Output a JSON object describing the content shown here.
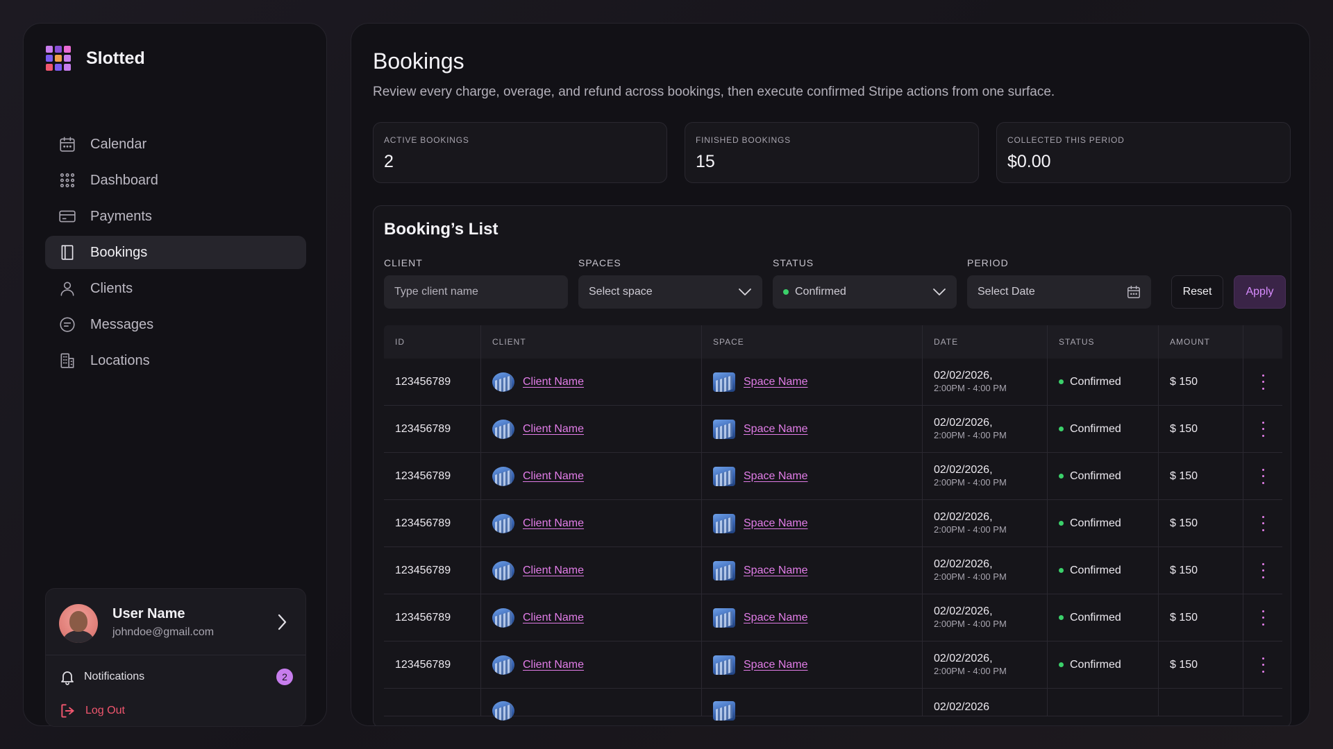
{
  "app": {
    "name": "Slotted",
    "logo_colors": [
      "#c77ded",
      "#8a4fd6",
      "#e96bd4",
      "#7b5cf0",
      "#f0a04b",
      "#c77ded",
      "#f0566e",
      "#7b5cf0",
      "#c77ded"
    ]
  },
  "nav": [
    {
      "label": "Calendar",
      "icon": "calendar-icon",
      "active": false
    },
    {
      "label": "Dashboard",
      "icon": "grid-icon",
      "active": false
    },
    {
      "label": "Payments",
      "icon": "credit-card-icon",
      "active": false
    },
    {
      "label": "Bookings",
      "icon": "book-icon",
      "active": true
    },
    {
      "label": "Clients",
      "icon": "user-icon",
      "active": false
    },
    {
      "label": "Messages",
      "icon": "message-icon",
      "active": false
    },
    {
      "label": "Locations",
      "icon": "building-icon",
      "active": false
    }
  ],
  "user": {
    "name": "User Name",
    "email": "johndoe@gmail.com",
    "notifications_label": "Notifications",
    "notifications_count": "2",
    "logout_label": "Log Out"
  },
  "page": {
    "title": "Bookings",
    "subtitle": "Review every charge, overage, and refund across bookings, then execute confirmed Stripe actions from one surface."
  },
  "stats": [
    {
      "label": "ACTIVE BOOKINGS",
      "value": "2"
    },
    {
      "label": "FINISHED BOOKINGS",
      "value": "15"
    },
    {
      "label": "COLLECTED THIS PERIOD",
      "value": "$0.00"
    }
  ],
  "list": {
    "title": "Booking’s List",
    "filters": {
      "client_label": "CLIENT",
      "client_placeholder": "Type client name",
      "spaces_label": "SPACES",
      "spaces_value": "Select space",
      "status_label": "STATUS",
      "status_value": "Confirmed",
      "period_label": "PERIOD",
      "period_value": "Select Date",
      "reset_label": "Reset",
      "apply_label": "Apply"
    },
    "columns": [
      "ID",
      "CLIENT",
      "SPACE",
      "DATE",
      "STATUS",
      "AMOUNT"
    ],
    "rows": [
      {
        "id": "123456789",
        "client": "Client Name",
        "space": "Space Name",
        "date": "02/02/2026,",
        "time": "2:00PM - 4:00 PM",
        "status": "Confirmed",
        "amount": "$ 150"
      },
      {
        "id": "123456789",
        "client": "Client Name",
        "space": "Space Name",
        "date": "02/02/2026,",
        "time": "2:00PM - 4:00 PM",
        "status": "Confirmed",
        "amount": "$ 150"
      },
      {
        "id": "123456789",
        "client": "Client Name",
        "space": "Space Name",
        "date": "02/02/2026,",
        "time": "2:00PM - 4:00 PM",
        "status": "Confirmed",
        "amount": "$ 150"
      },
      {
        "id": "123456789",
        "client": "Client Name",
        "space": "Space Name",
        "date": "02/02/2026,",
        "time": "2:00PM - 4:00 PM",
        "status": "Confirmed",
        "amount": "$ 150"
      },
      {
        "id": "123456789",
        "client": "Client Name",
        "space": "Space Name",
        "date": "02/02/2026,",
        "time": "2:00PM - 4:00 PM",
        "status": "Confirmed",
        "amount": "$ 150"
      },
      {
        "id": "123456789",
        "client": "Client Name",
        "space": "Space Name",
        "date": "02/02/2026,",
        "time": "2:00PM - 4:00 PM",
        "status": "Confirmed",
        "amount": "$ 150"
      },
      {
        "id": "123456789",
        "client": "Client Name",
        "space": "Space Name",
        "date": "02/02/2026,",
        "time": "2:00PM - 4:00 PM",
        "status": "Confirmed",
        "amount": "$ 150"
      }
    ],
    "partial_row_date": "02/02/2026"
  },
  "colors": {
    "accent": "#e27de8",
    "status_confirmed": "#3bd06a",
    "logout": "#f0566e"
  }
}
